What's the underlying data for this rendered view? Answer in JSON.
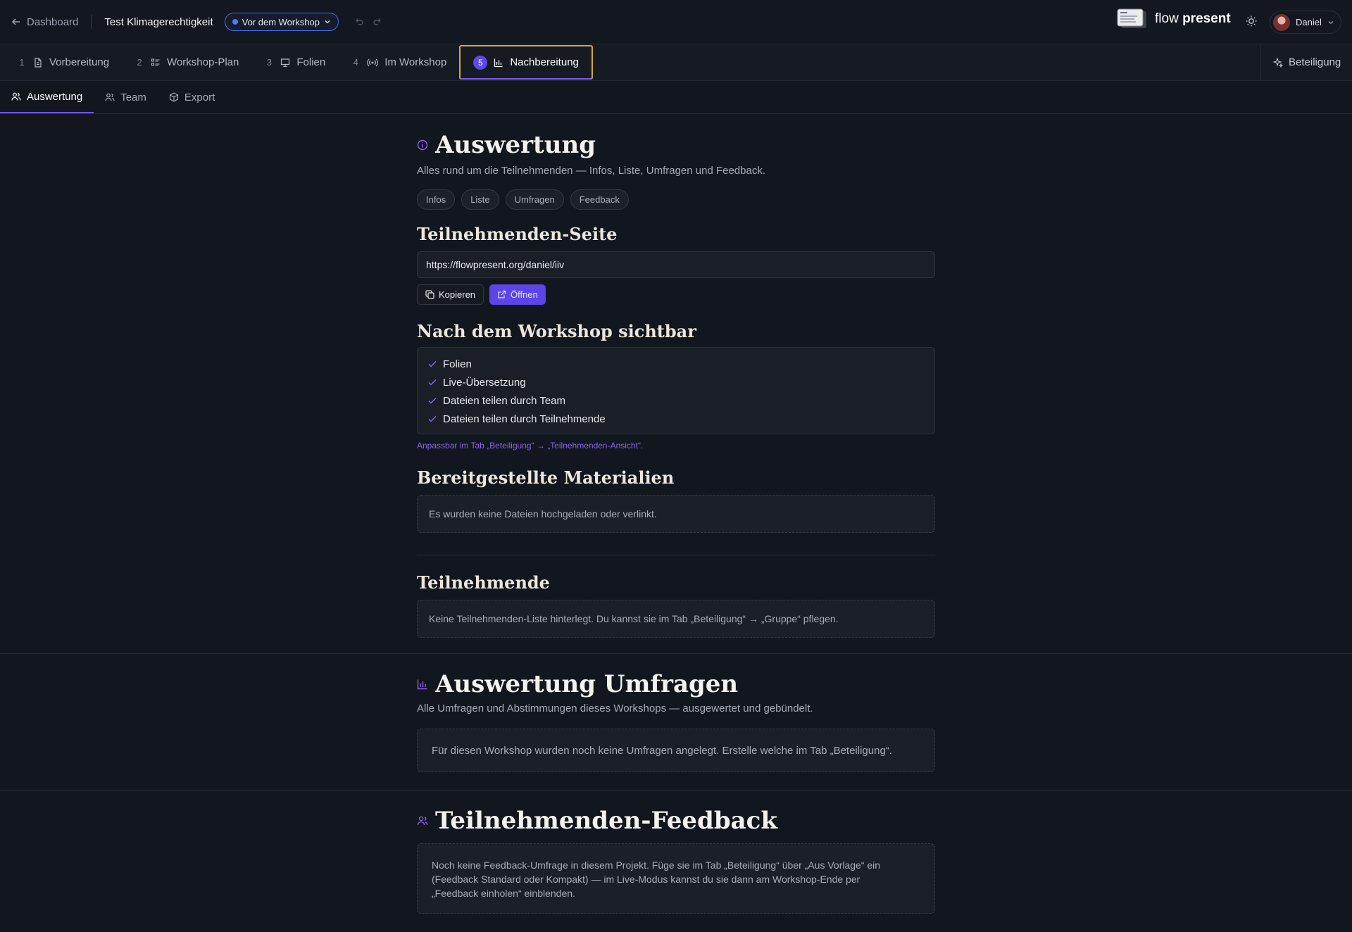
{
  "topbar": {
    "back_label": "Dashboard",
    "project_title": "Test Klimagerechtigkeit",
    "status_label": "Vor dem Workshop",
    "brand_word1": "flow",
    "brand_word2": "present",
    "user_name": "Daniel"
  },
  "steps": [
    {
      "num": "1",
      "label": "Vorbereitung",
      "icon": "document-icon"
    },
    {
      "num": "2",
      "label": "Workshop-Plan",
      "icon": "list-icon"
    },
    {
      "num": "3",
      "label": "Folien",
      "icon": "presentation-icon"
    },
    {
      "num": "4",
      "label": "Im Workshop",
      "icon": "broadcast-icon"
    },
    {
      "num": "5",
      "label": "Nachbereitung",
      "icon": "bar-chart-icon"
    }
  ],
  "participation_label": "Beteiligung",
  "subtabs": [
    {
      "label": "Auswertung",
      "icon": "users-icon"
    },
    {
      "label": "Team",
      "icon": "users-icon"
    },
    {
      "label": "Export",
      "icon": "package-icon"
    }
  ],
  "auswertung": {
    "title": "Auswertung",
    "subtitle": "Alles rund um die Teilnehmenden — Infos, Liste, Umfragen und Feedback.",
    "chips": [
      "Infos",
      "Liste",
      "Umfragen",
      "Feedback"
    ]
  },
  "teilnehmenden_seite": {
    "title": "Teilnehmenden-Seite",
    "url": "https://flowpresent.org/daniel/iiv",
    "copy_label": "Kopieren",
    "open_label": "Öffnen"
  },
  "nach_workshop": {
    "title": "Nach dem Workshop sichtbar",
    "items": [
      "Folien",
      "Live-Übersetzung",
      "Dateien teilen durch Team",
      "Dateien teilen durch Teilnehmende"
    ],
    "hint": "Anpassbar im Tab „Beteiligung“ → „Teilnehmenden-Ansicht“."
  },
  "materialien": {
    "title": "Bereitgestellte Materialien",
    "empty": "Es wurden keine Dateien hochgeladen oder verlinkt."
  },
  "teilnehmende": {
    "title": "Teilnehmende",
    "empty": "Keine Teilnehmenden-Liste hinterlegt. Du kannst sie im Tab „Beteiligung“ → „Gruppe“ pflegen."
  },
  "umfragen": {
    "title": "Auswertung Umfragen",
    "subtitle": "Alle Umfragen und Abstimmungen dieses Workshops — ausgewertet und gebündelt.",
    "empty": "Für diesen Workshop wurden noch keine Umfragen angelegt. Erstelle welche im Tab „Beteiligung“."
  },
  "feedback": {
    "title": "Teilnehmenden-Feedback",
    "empty_line1": "Noch keine Feedback-Umfrage in diesem Projekt. Füge sie im Tab „Beteiligung“ über „Aus Vorlage“ ein",
    "empty_line2": "(Feedback Standard oder Kompakt) — im Live-Modus kannst du sie dann am Workshop-Ende per",
    "empty_line3": "„Feedback einholen“ einblenden."
  },
  "colors": {
    "accent": "#5b45e8",
    "active_outline": "#d5a93d",
    "status_border": "#3b6df0",
    "hint": "#8a63f2"
  }
}
